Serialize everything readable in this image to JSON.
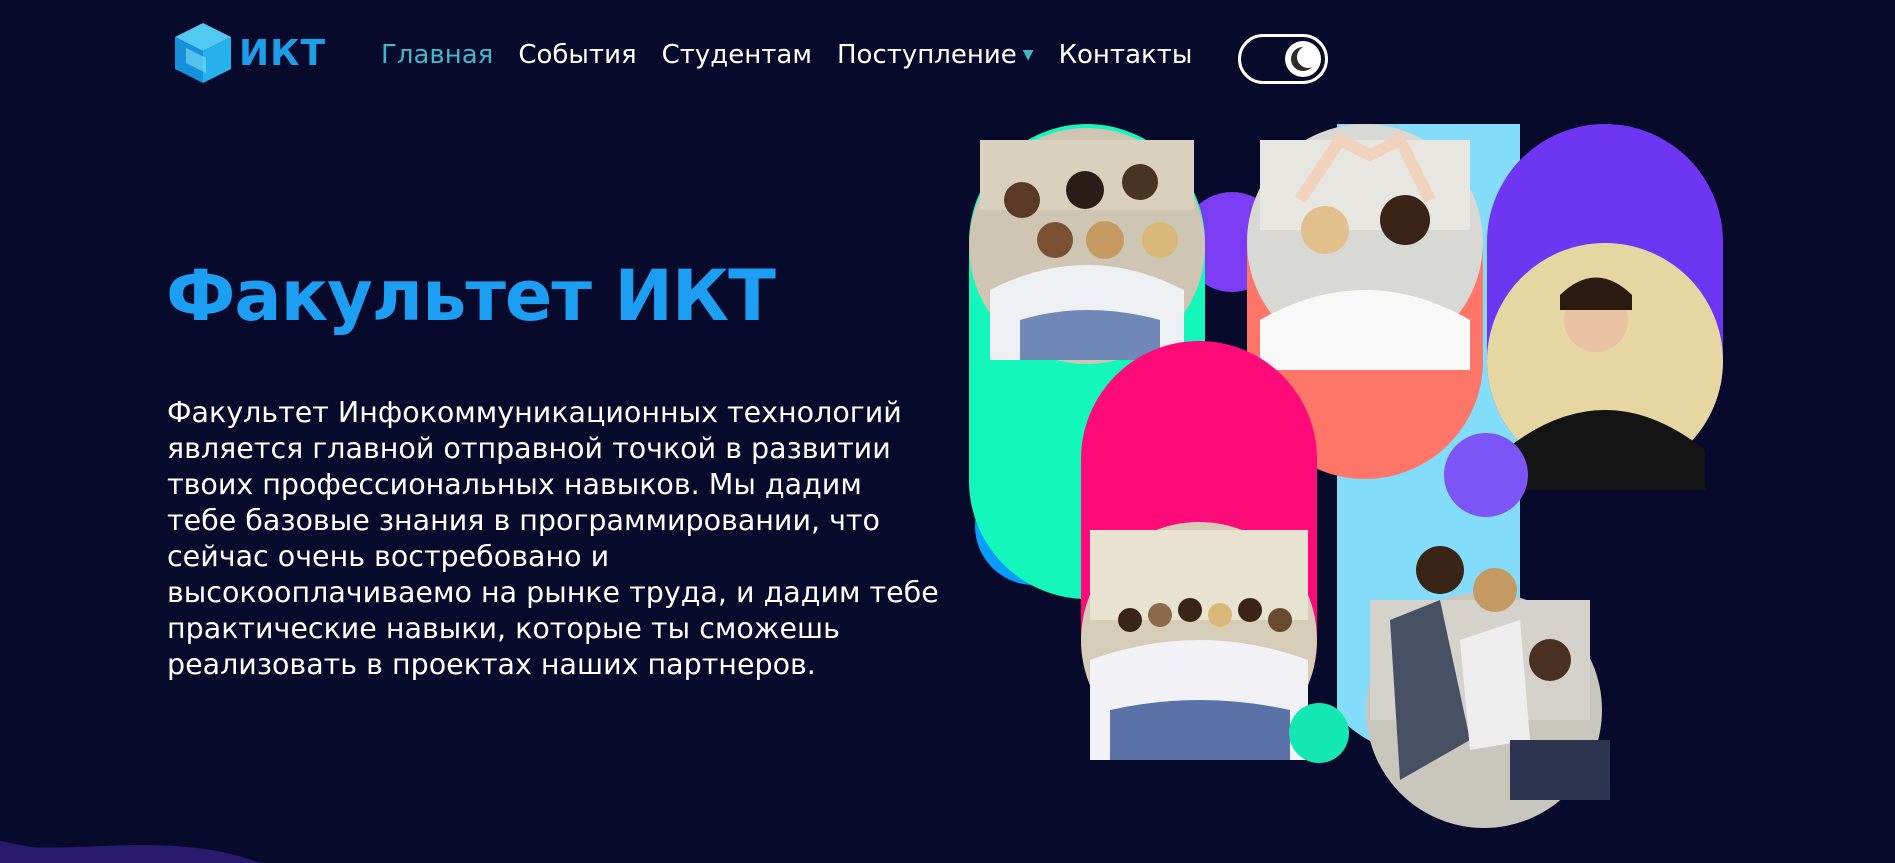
{
  "brand": {
    "logo_text": "ИКТ",
    "logo_icon": "cube-logo-icon"
  },
  "nav": {
    "items": [
      {
        "label": "Главная",
        "active": true
      },
      {
        "label": "События"
      },
      {
        "label": "Студентам"
      },
      {
        "label": "Поступление",
        "has_dropdown": true,
        "caret_icon": "caret-down-icon"
      },
      {
        "label": "Контакты"
      }
    ]
  },
  "theme_toggle": {
    "mode": "dark",
    "icon": "moon-icon"
  },
  "hero": {
    "title": "Факультет ИКТ",
    "description_lines": [
      "Факультет Инфокоммуникационных технологий",
      "является главной отправной точкой в развитии",
      "твоих профессиональных навыков. Мы дадим",
      "тебе базовые знания в программировании, что",
      "сейчас очень востребовано и",
      "высокооплачиваемо на рынке труда, и дадим тебе",
      "практические навыки, которые ты сможешь",
      "реализовать в проектах наших партнеров."
    ]
  },
  "collage": {
    "photos": [
      "group-selfie-photo",
      "heart-hands-photo",
      "student-hoodie-photo",
      "group-outdoor-photo",
      "students-laptop-photo"
    ]
  },
  "colors": {
    "background": "#080a2b",
    "accent_blue": "#1c9ef3",
    "nav_active": "#3fb8c9",
    "mint": "#14f7bb",
    "coral": "#ff7668",
    "pink": "#ff0a79",
    "violet": "#6e36f2",
    "light_blue": "#84dcfb",
    "sky_blue": "#069dfe"
  }
}
